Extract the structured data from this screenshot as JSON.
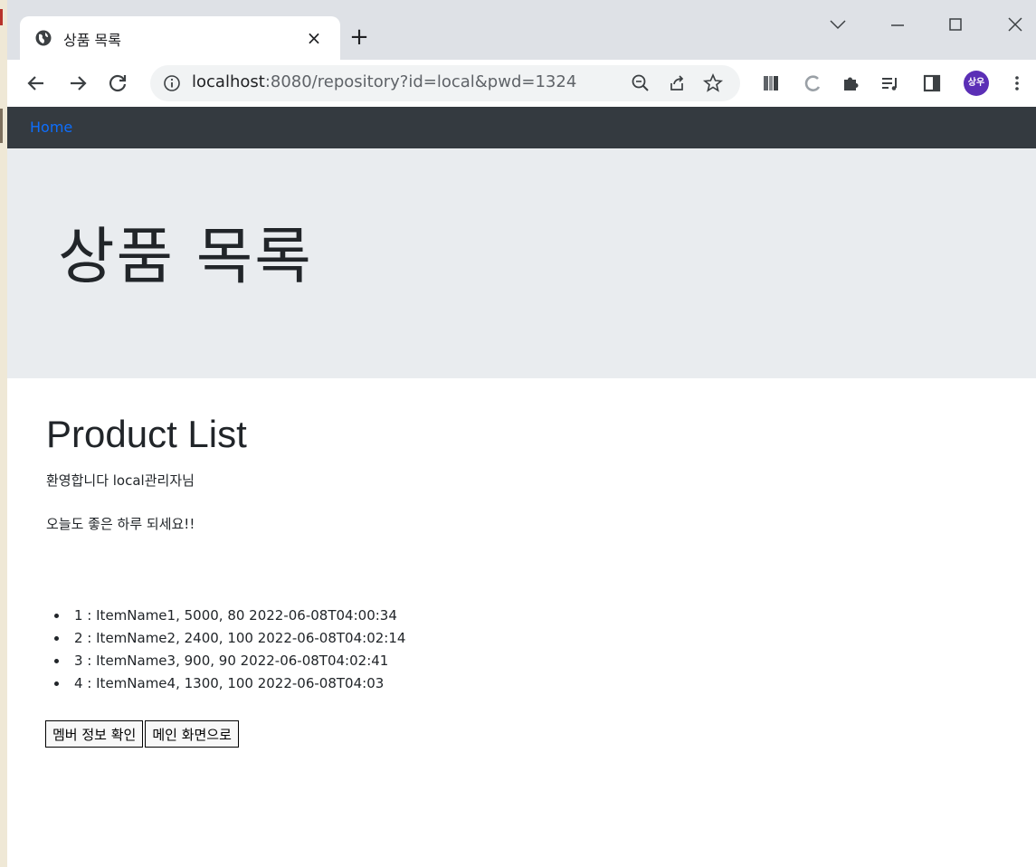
{
  "browser": {
    "tab_title": "상품 목록",
    "tab_close": "×",
    "new_tab": "+",
    "url_host": "localhost",
    "url_rest": ":8080/repository?id=local&pwd=1324",
    "profile_initials": "상우",
    "icons": [
      "globe-icon",
      "back-icon",
      "forward-icon",
      "reload-icon",
      "info-icon",
      "zoom-icon",
      "share-icon",
      "star-icon",
      "reading-list-icon",
      "extensions-icon",
      "media-icon",
      "sidepanel-icon",
      "menu-icon",
      "minimize-icon",
      "maximize-icon",
      "close-icon",
      "tab-search-icon"
    ]
  },
  "navbar": {
    "home_label": "Home"
  },
  "jumbotron": {
    "title": "상품 목록"
  },
  "main": {
    "heading": "Product List",
    "welcome": "환영합니다 local관리자님",
    "greeting": "오늘도 좋은 하루 되세요!!",
    "items": [
      "1 : ItemName1, 5000, 80 2022-06-08T04:00:34",
      "2 : ItemName2, 2400, 100 2022-06-08T04:02:14",
      "3 : ItemName3, 900, 90 2022-06-08T04:02:41",
      "4 : ItemName4, 1300, 100 2022-06-08T04:03"
    ],
    "buttons": {
      "member_info": "멤버 정보 확인",
      "to_main": "메인 화면으로"
    }
  },
  "colors": {
    "navbar_bg": "#343a40",
    "link": "#0d6efd",
    "jumbotron_bg": "#e9ecef",
    "tabbar_bg": "#dee1e6",
    "avatar_bg": "#5b2fb6"
  }
}
